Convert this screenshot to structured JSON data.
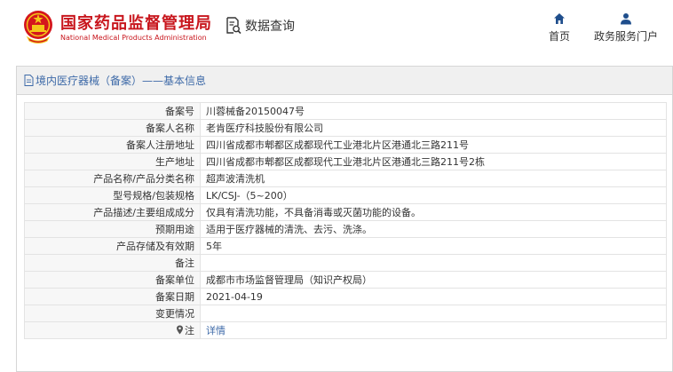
{
  "header": {
    "brand_cn": "国家药品监督管理局",
    "brand_en": "National Medical Products Administration",
    "query_label": "数据查询",
    "nav": [
      {
        "label": "首页",
        "icon": "home-icon"
      },
      {
        "label": "政务服务门户",
        "icon": "user-icon"
      }
    ]
  },
  "panel": {
    "title": "境内医疗器械（备案）——基本信息",
    "rows": [
      {
        "label": "备案号",
        "value": "川蓉械备20150047号"
      },
      {
        "label": "备案人名称",
        "value": "老肯医疗科技股份有限公司"
      },
      {
        "label": "备案人注册地址",
        "value": "四川省成都市郫都区成都现代工业港北片区港通北三路211号"
      },
      {
        "label": "生产地址",
        "value": "四川省成都市郫都区成都现代工业港北片区港通北三路211号2栋"
      },
      {
        "label": "产品名称/产品分类名称",
        "value": "超声波清洗机"
      },
      {
        "label": "型号规格/包装规格",
        "value": "LK/CSJ-（5~200）"
      },
      {
        "label": "产品描述/主要组成成分",
        "value": "仅具有清洗功能，不具备消毒或灭菌功能的设备。"
      },
      {
        "label": "预期用途",
        "value": "适用于医疗器械的清洗、去污、洗涤。"
      },
      {
        "label": "产品存储及有效期",
        "value": "5年"
      },
      {
        "label": "备注",
        "value": ""
      },
      {
        "label": "备案单位",
        "value": "成都市市场监督管理局（知识产权局）"
      },
      {
        "label": "备案日期",
        "value": "2021-04-19"
      },
      {
        "label": "变更情况",
        "value": ""
      },
      {
        "label": "注",
        "value": "详情"
      }
    ]
  },
  "colors": {
    "brand_red": "#c8161d",
    "link_blue": "#3e6aa8",
    "nav_blue": "#1f4e8c"
  }
}
